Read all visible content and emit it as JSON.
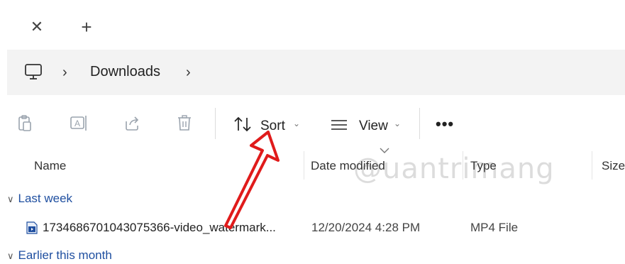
{
  "tabbar": {
    "close_symbol": "✕",
    "new_tab_symbol": "+"
  },
  "address": {
    "root_icon": "monitor-icon",
    "separator": "›",
    "crumbs": [
      "Downloads"
    ]
  },
  "toolbar": {
    "icons": [
      "paste-icon",
      "rename-icon",
      "share-icon",
      "delete-icon"
    ],
    "sort_label": "Sort",
    "view_label": "View",
    "more_label": "•••",
    "caret": "⌄"
  },
  "columns": {
    "name": "Name",
    "date_modified": "Date modified",
    "type": "Type",
    "size": "Size"
  },
  "groups": [
    {
      "label": "Last week",
      "files": [
        {
          "name": "1734686701043075366-video_watermark...",
          "date": "12/20/2024 4:28 PM",
          "type": "MP4 File",
          "icon": "video-file-icon"
        }
      ]
    },
    {
      "label": "Earlier this month",
      "files": []
    }
  ],
  "watermark": {
    "text": "@uantrimang"
  },
  "colors": {
    "accent_red": "#e01b1b",
    "group_blue": "#1f4fa0",
    "address_bg": "#f3f3f3"
  }
}
